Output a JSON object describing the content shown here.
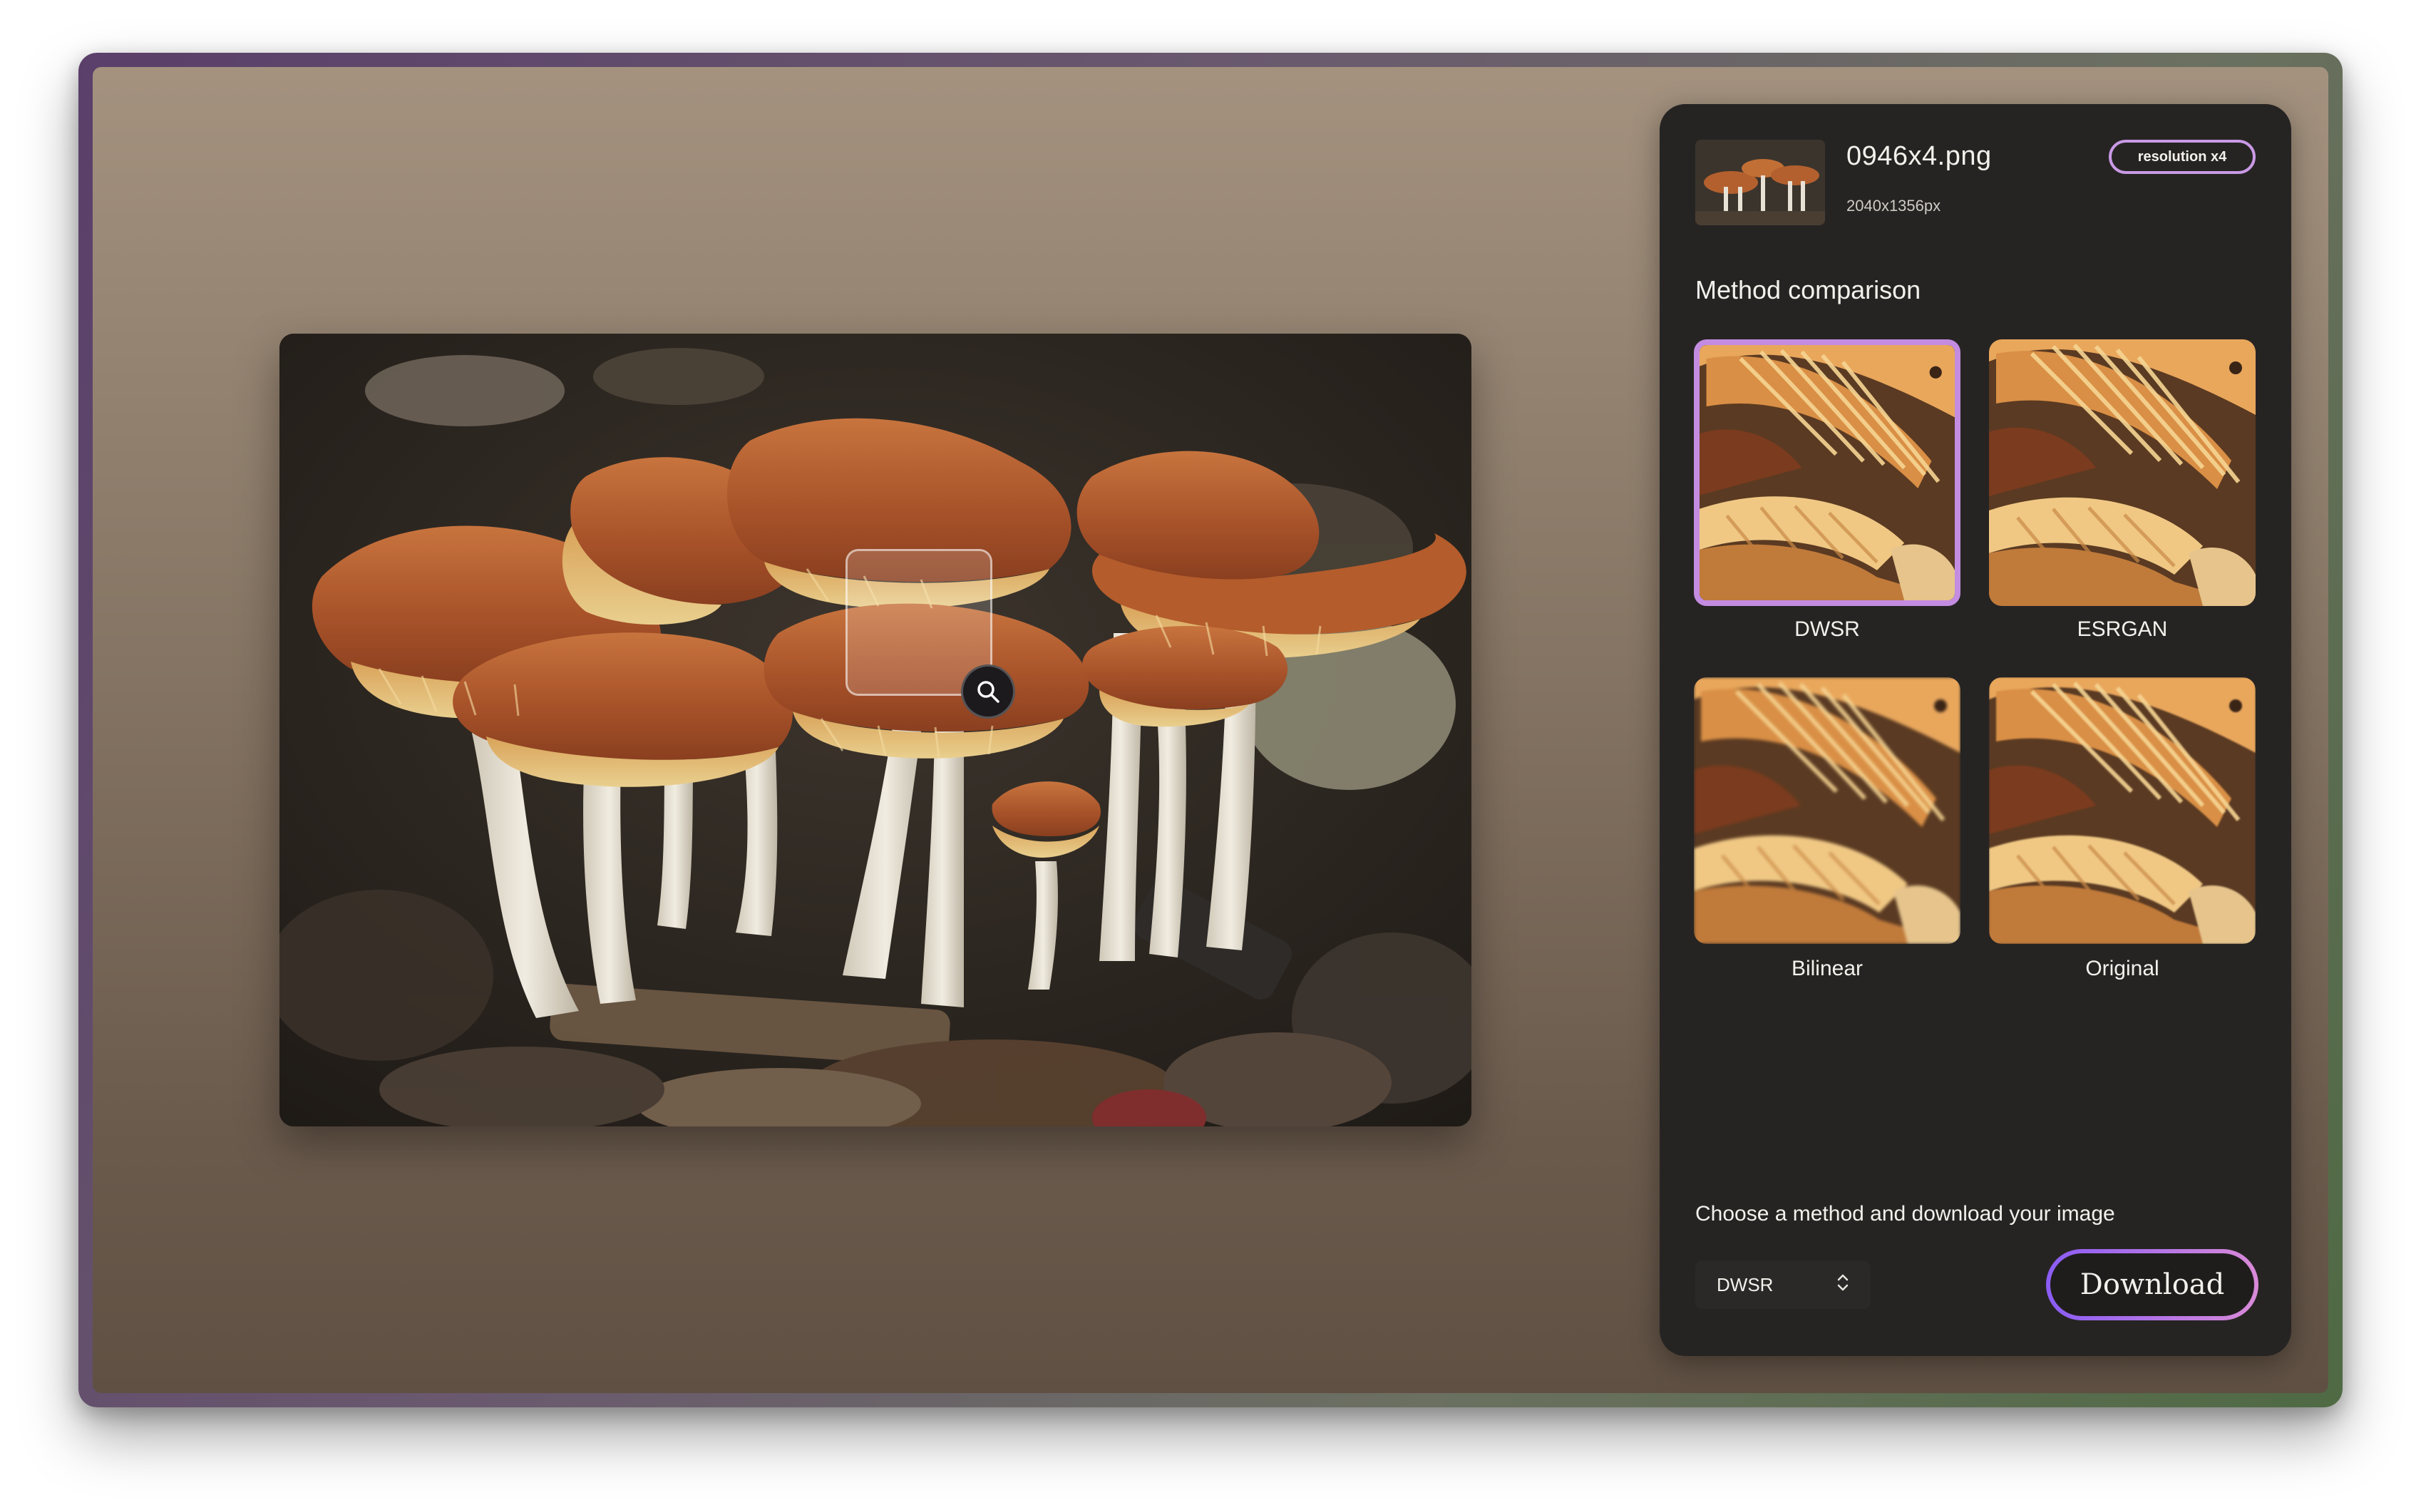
{
  "file": {
    "name": "0946x4.png",
    "dimensions": "2040x1356px",
    "badge": "resolution x4"
  },
  "panel": {
    "section_title": "Method comparison",
    "methods": [
      {
        "label": "DWSR",
        "selected": true
      },
      {
        "label": "ESRGAN",
        "selected": false
      },
      {
        "label": "Bilinear",
        "selected": false
      },
      {
        "label": "Original",
        "selected": false
      }
    ],
    "hint": "Choose a method and download your image",
    "select_value": "DWSR",
    "download_label": "Download"
  },
  "colors": {
    "accent": "#c38ce0",
    "panel_bg": "#262423",
    "download_gradient_start": "#8a5cf5",
    "download_gradient_end": "#d98ad8"
  },
  "icons": {
    "loupe": "magnifier-icon",
    "select": "chevron-up-down-icon"
  }
}
